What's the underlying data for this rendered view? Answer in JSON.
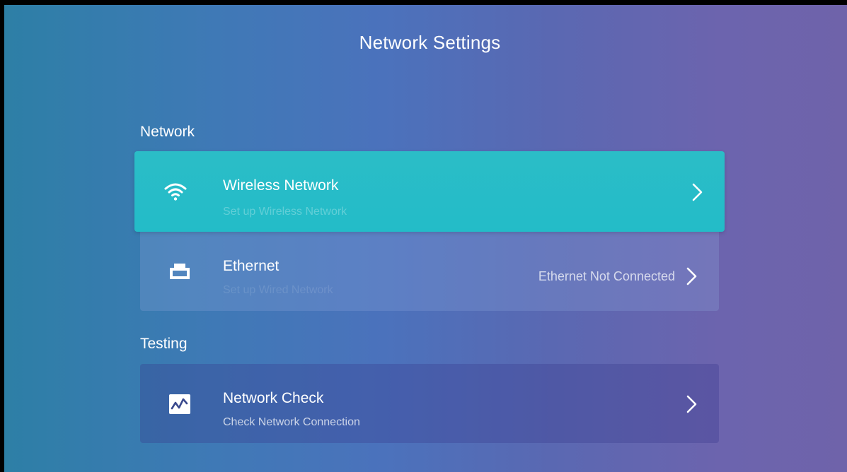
{
  "header": {
    "title": "Network Settings"
  },
  "sections": [
    {
      "label": "Network",
      "items": [
        {
          "title": "Wireless Network",
          "subtitle": "Set up Wireless Network",
          "icon": "wifi-icon",
          "status": "",
          "focused": true
        },
        {
          "title": "Ethernet",
          "subtitle": "Set up Wired Network",
          "icon": "ethernet-icon",
          "status": "Ethernet Not Connected",
          "focused": false
        }
      ]
    },
    {
      "label": "Testing",
      "items": [
        {
          "title": "Network Check",
          "subtitle": "Check Network Connection",
          "icon": "network-check-icon",
          "status": "",
          "focused": false
        }
      ]
    }
  ],
  "colors": {
    "focus_accent": "#23bcc8",
    "text": "#ffffff"
  }
}
